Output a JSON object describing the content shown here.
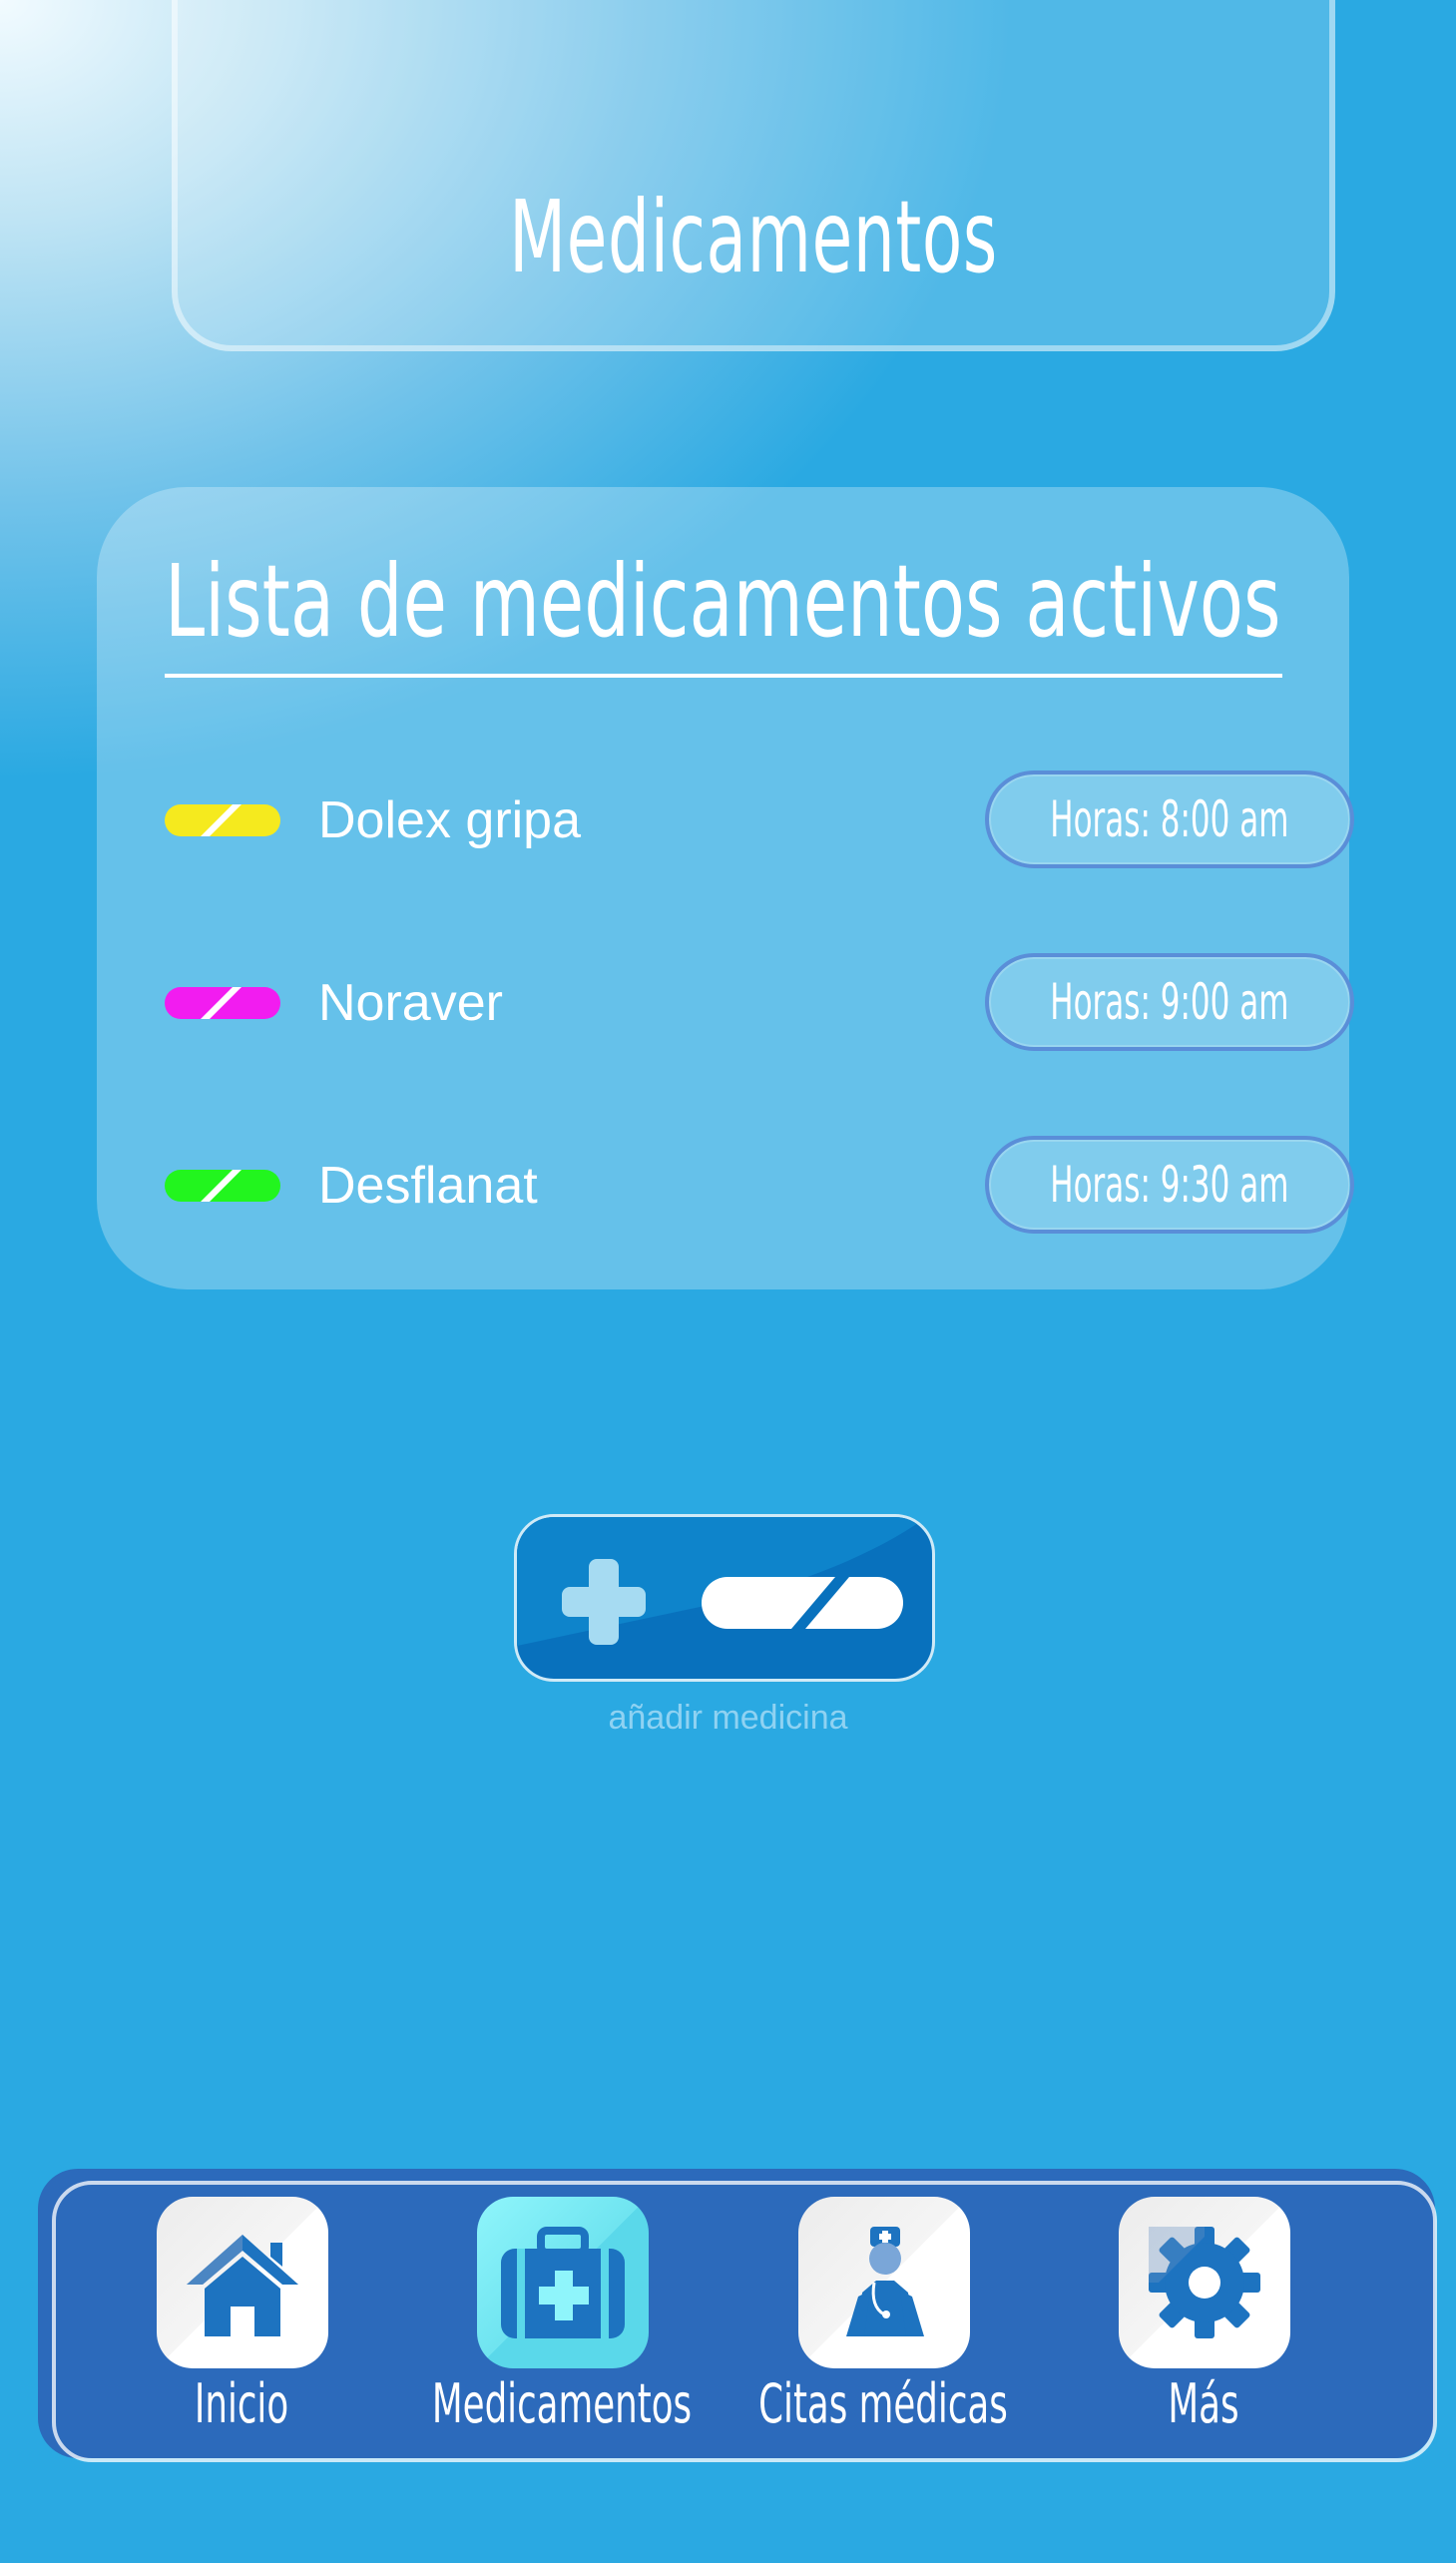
{
  "header": {
    "title": "Medicamentos"
  },
  "card": {
    "title": "Lista de medicamentos activos",
    "medications": [
      {
        "name": "Dolex gripa",
        "schedule": "Horas: 8:00 am",
        "color": "#f5ea1e"
      },
      {
        "name": "Noraver",
        "schedule": "Horas: 9:00 am",
        "color": "#f21cf0"
      },
      {
        "name": "Desflanat",
        "schedule": "Horas: 9:30 am",
        "color": "#22f51e"
      }
    ]
  },
  "add_button": {
    "label": "añadir medicina",
    "icons": [
      "plus-icon",
      "pill-icon"
    ]
  },
  "bottom_nav": {
    "items": [
      {
        "label": "Inicio",
        "icon": "home-icon",
        "active": false
      },
      {
        "label": "Medicamentos",
        "icon": "medical-kit-icon",
        "active": true
      },
      {
        "label": "Citas médicas",
        "icon": "doctor-icon",
        "active": false
      },
      {
        "label": "Más",
        "icon": "gear-icon",
        "active": false
      }
    ]
  },
  "colors": {
    "background": "#2aa9e2",
    "nav": "#2c6abb",
    "accent": "#0871bd"
  }
}
